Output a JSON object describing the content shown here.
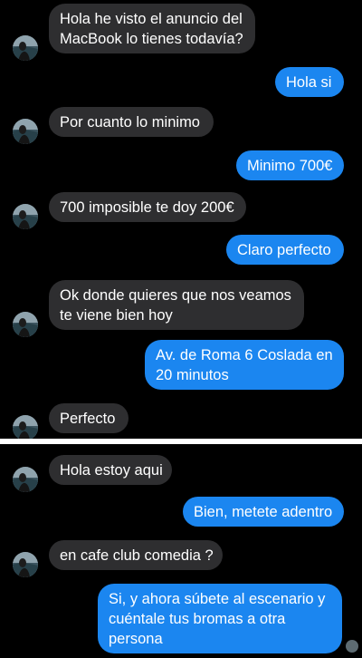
{
  "conversation_top": [
    {
      "side": "in",
      "text": "Hola he visto el anuncio del\nMacBook lo tienes todavía?"
    },
    {
      "side": "out",
      "text": "Hola si"
    },
    {
      "side": "in",
      "text": "Por cuanto lo minimo"
    },
    {
      "side": "out",
      "text": "Minimo 700€"
    },
    {
      "side": "in",
      "text": "700 imposible te doy 200€"
    },
    {
      "side": "out",
      "text": "Claro perfecto"
    },
    {
      "side": "in",
      "text": "Ok donde quieres que nos veamos\nte viene bien hoy"
    },
    {
      "side": "out",
      "text": "Av. de Roma 6 Coslada en\n20 minutos"
    },
    {
      "side": "in",
      "text": "Perfecto"
    }
  ],
  "conversation_bottom": [
    {
      "side": "in",
      "text": "Hola estoy aqui"
    },
    {
      "side": "out",
      "text": "Bien, metete adentro"
    },
    {
      "side": "in",
      "text": "en cafe club comedia ?"
    },
    {
      "side": "out",
      "text": "Si, y ahora súbete al escenario y\ncuéntale tus bromas a otra\npersona"
    }
  ],
  "colors": {
    "background": "#000000",
    "incoming_bubble": "#2e2e30",
    "outgoing_bubble": "#1b86f0",
    "text": "#ffffff"
  },
  "icons": {
    "contact_avatar": "contact-avatar-icon",
    "read_receipt_avatar": "read-receipt-avatar-icon"
  }
}
